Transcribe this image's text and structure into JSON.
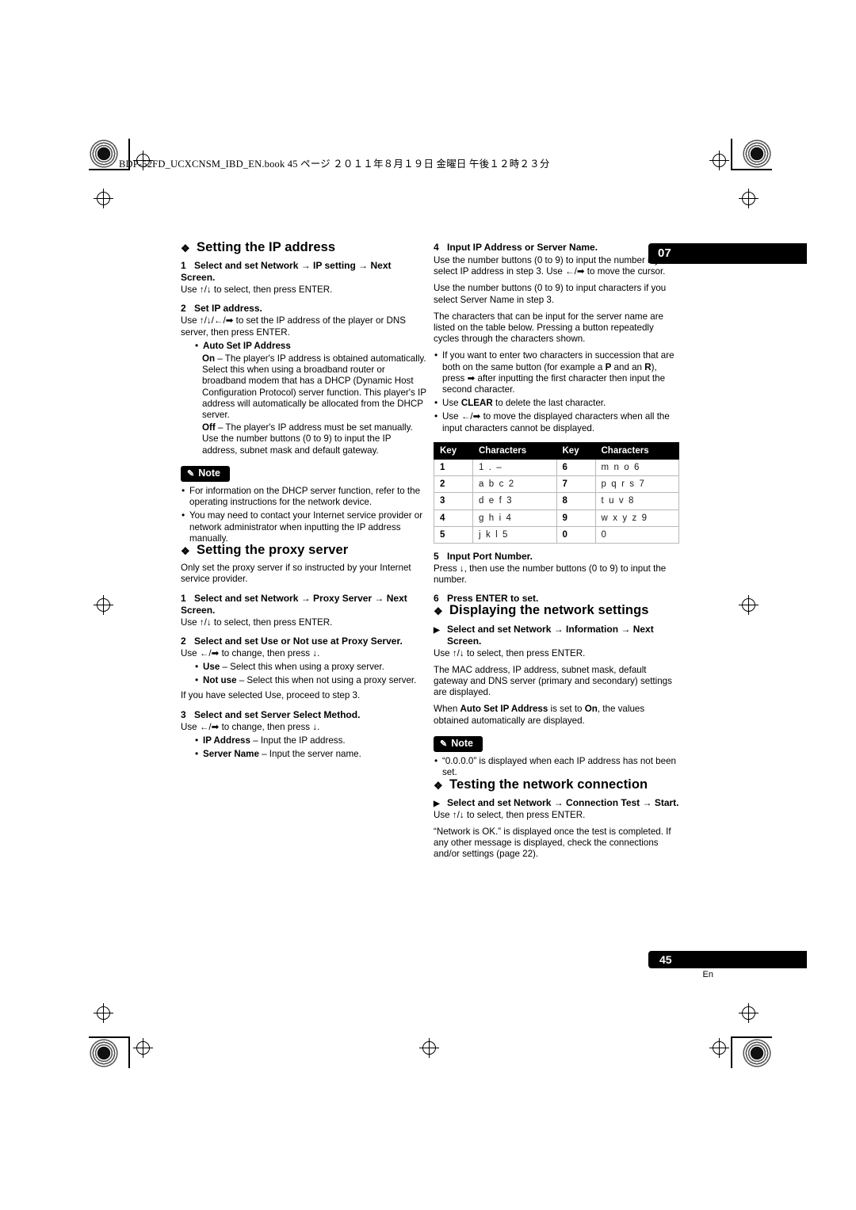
{
  "header_line": "BDP-52FD_UCXCNSM_IBD_EN.book   45 ページ   ２０１１年８月１９日   金曜日   午後１２時２３分",
  "chapter_tab": "07",
  "page_number": "45",
  "page_lang": "En",
  "left_column": {
    "section1_title": "Setting the IP address",
    "s1_step1_head": "Select and set Network → IP setting → Next Screen.",
    "s1_step1_body": "Use ↑/↓ to select, then press ENTER.",
    "s1_step2_head": "Set IP address.",
    "s1_step2_body": "Use ↑/↓/←/➡ to set the IP address of the player or DNS server, then press ENTER.",
    "auto_set_head": "Auto Set IP Address",
    "on_label": "On",
    "on_text": " – The player's IP address is obtained automatically. Select this when using a broadband router or broadband modem that has a DHCP (Dynamic Host Configuration Protocol) server function. This player's IP address will automatically be allocated from the DHCP server.",
    "off_label": "Off",
    "off_text": " – The player's IP address must be set manually. Use the number buttons (0 to 9) to input the IP address, subnet mask and default gateway.",
    "note_title": "Note",
    "note_b1": "For information on the DHCP server function, refer to the operating instructions for the network device.",
    "note_b2": "You may need to contact your Internet service provider or network administrator when inputting the IP address manually.",
    "section2_title": "Setting the proxy server",
    "s2_intro": "Only set the proxy server if so instructed by your Internet service provider.",
    "s2_step1_head": "Select and set Network → Proxy Server → Next Screen.",
    "s2_step1_body": "Use ↑/↓ to select, then press ENTER.",
    "s2_step2_head": "Select and set Use or Not use at Proxy Server.",
    "s2_step2_body": "Use ←/➡ to change, then press ↓.",
    "s2_b1_label": "Use",
    "s2_b1_text": " – Select this when using a proxy server.",
    "s2_b2_label": "Not use",
    "s2_b2_text": " – Select this when not using a proxy server.",
    "s2_after": "If you have selected Use, proceed to step 3.",
    "s2_step3_head": "Select and set Server Select Method.",
    "s2_step3_body": "Use ←/➡ to change, then press ↓.",
    "s2_b3_label": "IP Address",
    "s2_b3_text": " – Input the IP address.",
    "s2_b4_label": "Server Name",
    "s2_b4_text": " – Input the server name."
  },
  "right_column": {
    "s1_step4_head": "Input IP Address or Server Name.",
    "s1_step4_p1": "Use the number buttons (0 to 9) to input the number if you select IP address in step 3. Use ←/➡ to move the cursor.",
    "s1_step4_p2": "Use the number buttons (0 to 9) to input characters if you select Server Name in step 3.",
    "s1_step4_p3": "The characters that can be input for the server name are listed on the table below. Pressing a button repeatedly cycles through the characters shown.",
    "s1_step4_b1a": "If you want to enter two characters in succession that are both on the same button (for example a ",
    "s1_step4_b1_P": "P",
    "s1_step4_b1b": " and an ",
    "s1_step4_b1_R": "R",
    "s1_step4_b1c": "), press ➡ after inputting the first character then input the second character.",
    "s1_step4_b2a": "Use ",
    "s1_step4_b2_CLEAR": "CLEAR",
    "s1_step4_b2b": " to delete the last character.",
    "s1_step4_b3": "Use ←/➡ to move the displayed characters when all the input characters cannot be displayed.",
    "table": {
      "headers": [
        "Key",
        "Characters",
        "Key",
        "Characters"
      ],
      "rows": [
        [
          "1",
          "1 . –",
          "6",
          "m n o 6"
        ],
        [
          "2",
          "a b c 2",
          "7",
          "p q r s 7"
        ],
        [
          "3",
          "d e f 3",
          "8",
          "t u v 8"
        ],
        [
          "4",
          "g h i 4",
          "9",
          "w x y z 9"
        ],
        [
          "5",
          "j k l 5",
          "0",
          "0"
        ]
      ]
    },
    "s1_step5_head": "Input Port Number.",
    "s1_step5_body": "Press ↓, then use the number buttons (0 to 9) to input the number.",
    "s1_step6_head": "Press ENTER to set.",
    "section3_title": "Displaying the network settings",
    "s3_step_head": "Select and set Network → Information → Next Screen.",
    "s3_step_body": "Use ↑/↓ to select, then press ENTER.",
    "s3_p1": "The MAC address, IP address, subnet mask, default gateway and DNS server (primary and secondary) settings are displayed.",
    "s3_p2_a": "When ",
    "s3_p2_b": "Auto Set IP Address",
    "s3_p2_c": " is set to ",
    "s3_p2_d": "On",
    "s3_p2_e": ", the values obtained automatically are displayed.",
    "note_title": "Note",
    "note_b1": "“0.0.0.0” is displayed when each IP address has not been set.",
    "section4_title": "Testing the network connection",
    "s4_step_head": "Select and set Network → Connection Test → Start.",
    "s4_step_body": "Use ↑/↓ to select, then press ENTER.",
    "s4_p1": "“Network is OK.” is displayed once the test is completed. If any other message is displayed, check the connections and/or settings (page 22)."
  }
}
